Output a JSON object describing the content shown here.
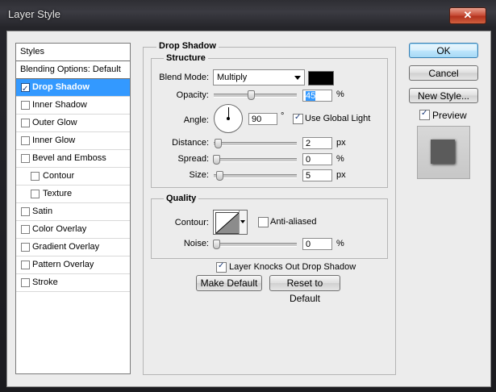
{
  "window": {
    "title": "Layer Style",
    "close_glyph": "✕"
  },
  "style_list": {
    "items": [
      {
        "label": "Styles",
        "type": "header"
      },
      {
        "label": "Blending Options: Default",
        "type": "header"
      },
      {
        "label": "Drop Shadow",
        "checked": true,
        "selected": true
      },
      {
        "label": "Inner Shadow",
        "checked": false
      },
      {
        "label": "Outer Glow",
        "checked": false
      },
      {
        "label": "Inner Glow",
        "checked": false
      },
      {
        "label": "Bevel and Emboss",
        "checked": false
      },
      {
        "label": "Contour",
        "checked": false,
        "indent": true
      },
      {
        "label": "Texture",
        "checked": false,
        "indent": true
      },
      {
        "label": "Satin",
        "checked": false
      },
      {
        "label": "Color Overlay",
        "checked": false
      },
      {
        "label": "Gradient Overlay",
        "checked": false
      },
      {
        "label": "Pattern Overlay",
        "checked": false
      },
      {
        "label": "Stroke",
        "checked": false
      }
    ]
  },
  "panel": {
    "title": "Drop Shadow",
    "structure": {
      "title": "Structure",
      "blend_mode_label": "Blend Mode:",
      "blend_mode_value": "Multiply",
      "shadow_color": "#000000",
      "opacity_label": "Opacity:",
      "opacity_value": "45",
      "opacity_fraction": 0.45,
      "angle_label": "Angle:",
      "angle_value": "90",
      "angle_unit": "°",
      "use_global_light_label": "Use Global Light",
      "use_global_light": true,
      "distance_label": "Distance:",
      "distance_value": "2",
      "spread_label": "Spread:",
      "spread_value": "0",
      "size_label": "Size:",
      "size_value": "5",
      "px_unit": "px",
      "pct_unit": "%"
    },
    "quality": {
      "title": "Quality",
      "contour_label": "Contour:",
      "anti_aliased_label": "Anti-aliased",
      "anti_aliased": false,
      "noise_label": "Noise:",
      "noise_value": "0",
      "pct_unit": "%"
    },
    "knockout_label": "Layer Knocks Out Drop Shadow",
    "knockout": true,
    "make_default_label": "Make Default",
    "reset_default_label": "Reset to Default"
  },
  "actions": {
    "ok_label": "OK",
    "cancel_label": "Cancel",
    "new_style_label": "New Style...",
    "preview_label": "Preview",
    "preview_checked": true
  }
}
